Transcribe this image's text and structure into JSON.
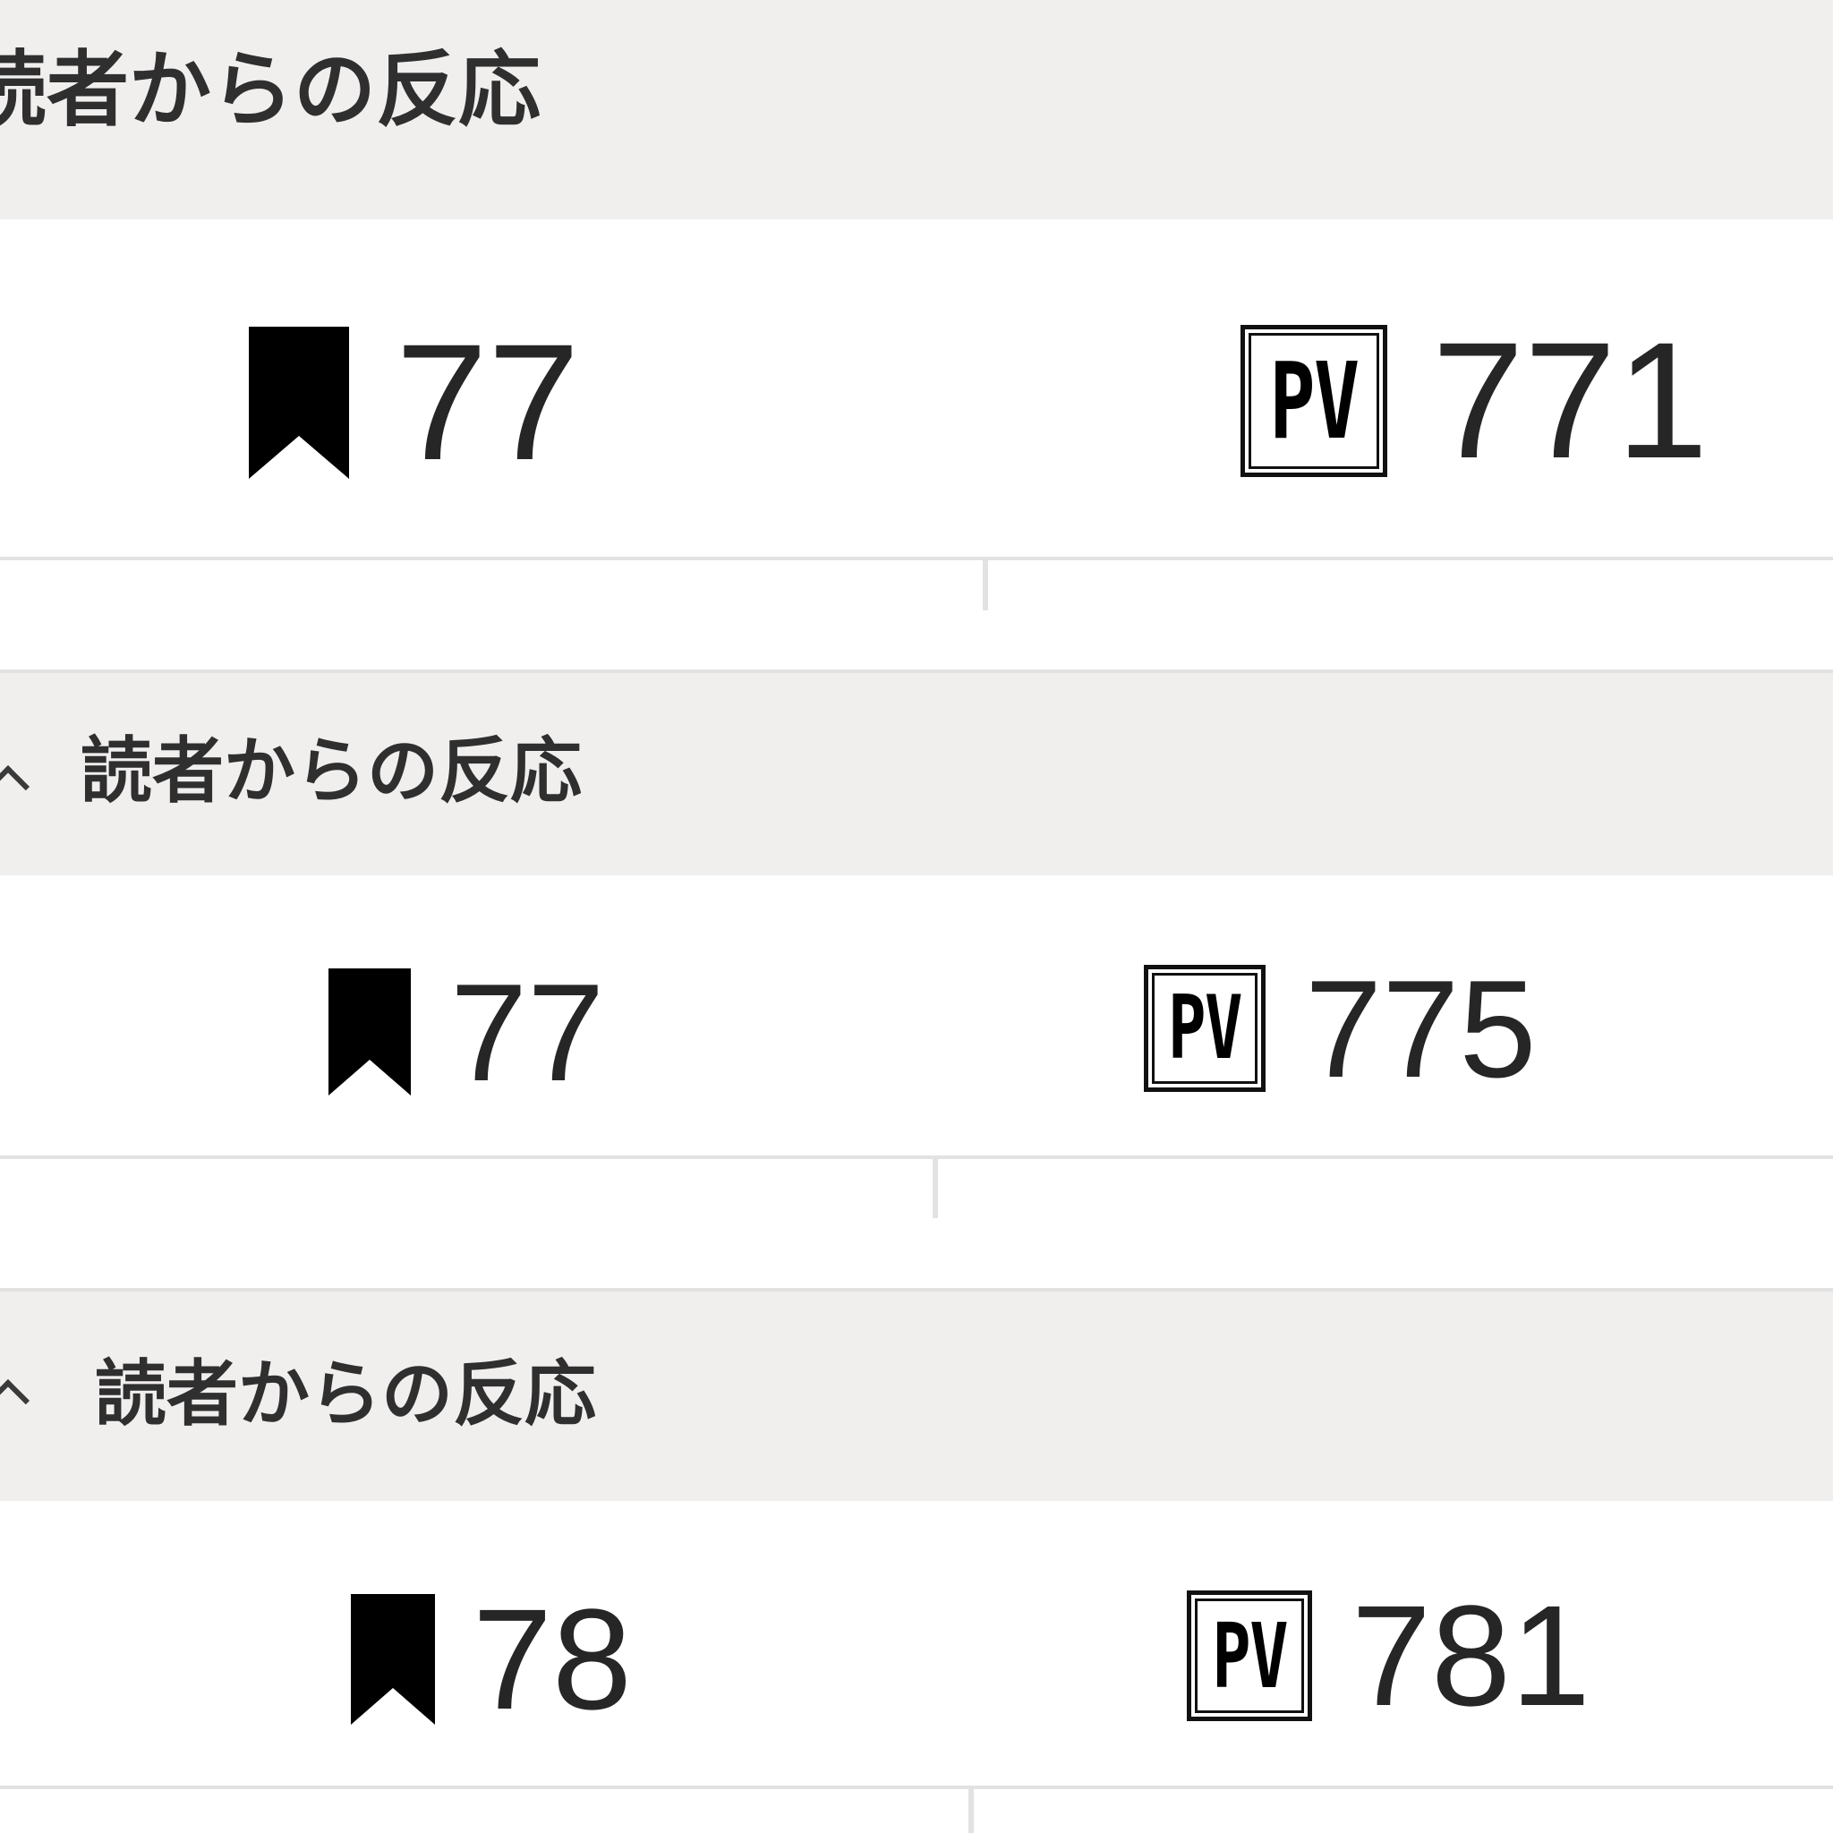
{
  "panels": [
    {
      "header_title": "読者からの反応",
      "bookmark_count": "77",
      "pv_icon_label": "PV",
      "pv_count": "771"
    },
    {
      "header_title": "読者からの反応",
      "bookmark_count": "77",
      "pv_icon_label": "PV",
      "pv_count": "775"
    },
    {
      "header_title": "読者からの反応",
      "bookmark_count": "78",
      "pv_icon_label": "PV",
      "pv_count": "781"
    }
  ],
  "colors": {
    "header_bg": "#f1efee",
    "divider": "#e2e2e2",
    "text": "#262626"
  },
  "icons": [
    "bookmark-icon",
    "pv-icon",
    "chevron-up-icon"
  ]
}
